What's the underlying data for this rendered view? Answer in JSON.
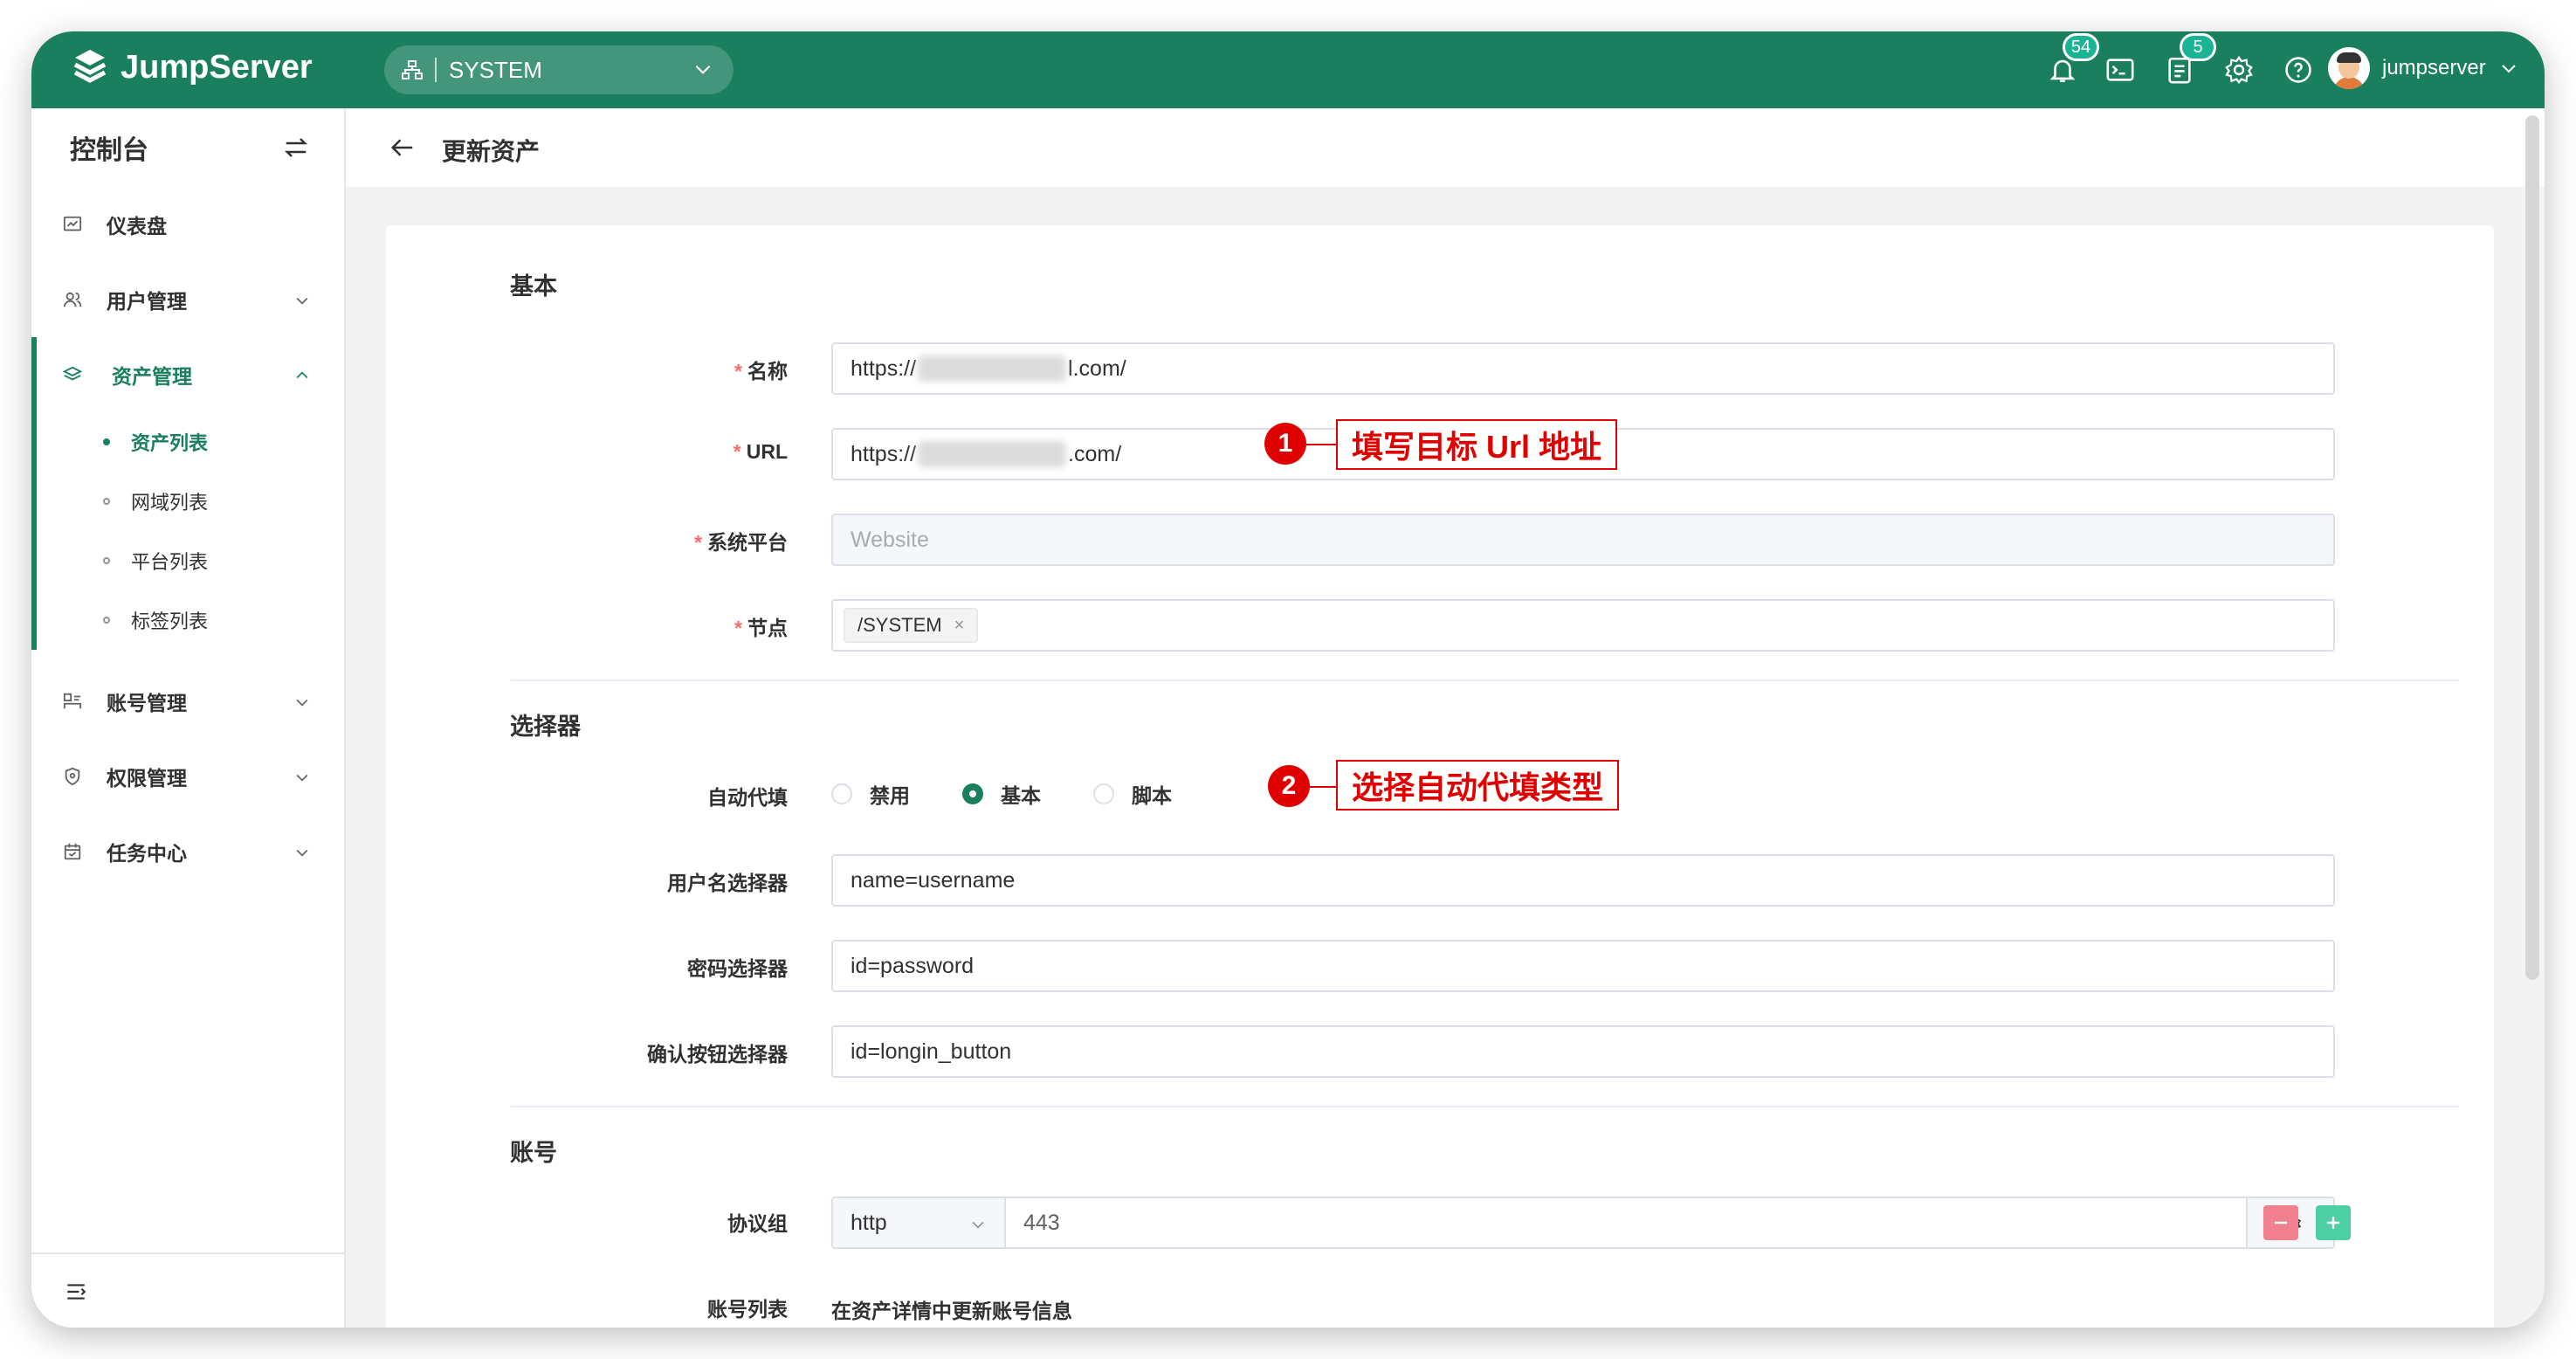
{
  "header": {
    "brand": "JumpServer",
    "org": "SYSTEM",
    "notifications_count": "54",
    "tickets_count": "5",
    "username": "jumpserver"
  },
  "sidebar": {
    "title": "控制台",
    "items": [
      {
        "label": "仪表盘"
      },
      {
        "label": "用户管理"
      },
      {
        "label": "资产管理"
      },
      {
        "label": "账号管理"
      },
      {
        "label": "权限管理"
      },
      {
        "label": "任务中心"
      }
    ],
    "asset_sub": [
      {
        "label": "资产列表"
      },
      {
        "label": "网域列表"
      },
      {
        "label": "平台列表"
      },
      {
        "label": "标签列表"
      }
    ]
  },
  "page": {
    "title": "更新资产"
  },
  "form": {
    "section_basic": "基本",
    "name_label": "名称",
    "name_prefix": "https://",
    "name_suffix": "l.com/",
    "url_label": "URL",
    "url_prefix": "https://",
    "url_suffix": ".com/",
    "platform_label": "系统平台",
    "platform_value": "Website",
    "node_label": "节点",
    "node_tag": "/SYSTEM",
    "section_selector": "选择器",
    "autofill_label": "自动代填",
    "autofill_options": [
      "禁用",
      "基本",
      "脚本"
    ],
    "autofill_selected": "基本",
    "username_selector_label": "用户名选择器",
    "username_selector_value": "name=username",
    "password_selector_label": "密码选择器",
    "password_selector_value": "id=password",
    "submit_selector_label": "确认按钮选择器",
    "submit_selector_value": "id=longin_button",
    "section_account": "账号",
    "protocol_label": "协议组",
    "protocol_name": "http",
    "protocol_port": "443",
    "accounts_label": "账号列表",
    "accounts_text": "在资产详情中更新账号信息"
  },
  "annotations": [
    {
      "num": "1",
      "text": "填写目标 Url 地址"
    },
    {
      "num": "2",
      "text": "选择自动代填类型"
    }
  ],
  "colors": {
    "brand": "#1a7f5e",
    "required": "#f56c6c",
    "annotation": "#e00000",
    "remove_button": "#f0808d",
    "add_button": "#4ccfa3"
  }
}
